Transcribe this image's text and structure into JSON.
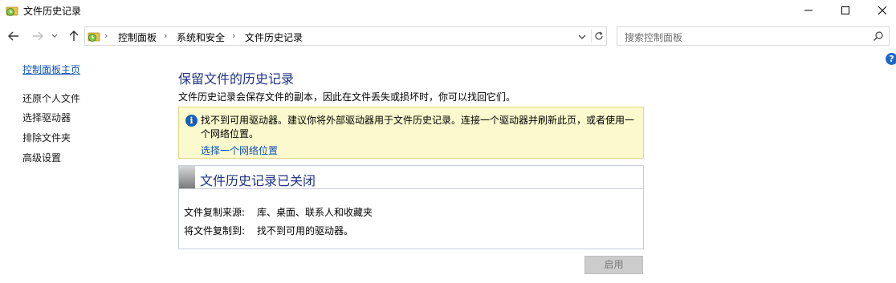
{
  "window": {
    "title": "文件历史记录"
  },
  "address": {
    "crumbs": [
      "控制面板",
      "系统和安全",
      "文件历史记录"
    ]
  },
  "search": {
    "placeholder": "搜索控制面板"
  },
  "sidebar": {
    "items": [
      {
        "label": "控制面板主页"
      },
      {
        "label": "还原个人文件"
      },
      {
        "label": "选择驱动器"
      },
      {
        "label": "排除文件夹"
      },
      {
        "label": "高级设置"
      }
    ]
  },
  "main": {
    "title": "保留文件的历史记录",
    "description": "文件历史记录会保存文件的副本，因此在文件丢失或损坏时，你可以找回它们。",
    "info": {
      "message": "找不到可用驱动器。建议你将外部驱动器用于文件历史记录。连接一个驱动器并刷新此页，或者使用一个网络位置。",
      "link": "选择一个网络位置"
    },
    "status": {
      "title": "文件历史记录已关闭",
      "rows": [
        {
          "label": "文件复制来源:",
          "value": "库、桌面、联系人和收藏夹"
        },
        {
          "label": "将文件复制到:",
          "value": "找不到可用的驱动器。"
        }
      ]
    },
    "enable_button": "启用"
  },
  "colors": {
    "heading": "#1e3287",
    "link": "#0b52b5",
    "info_background": "#fbf9cd"
  }
}
